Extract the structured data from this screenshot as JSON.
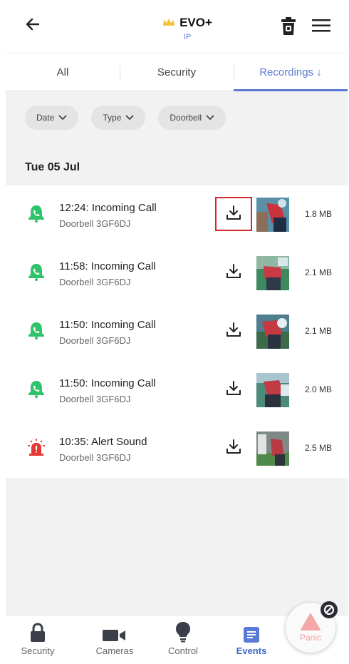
{
  "header": {
    "title": "EVO+",
    "subtitle": "IP",
    "icons": {
      "back": "arrow-left-icon",
      "crown": "crown-icon",
      "trash": "trash-icon",
      "menu": "hamburger-menu-icon"
    },
    "crown_color": "#f5c33b"
  },
  "tabs": [
    {
      "label": "All",
      "active": false
    },
    {
      "label": "Security",
      "active": false
    },
    {
      "label": "Recordings ↓",
      "active": true
    }
  ],
  "filters": [
    {
      "label": "Date"
    },
    {
      "label": "Type"
    },
    {
      "label": "Doorbell"
    }
  ],
  "date_heading": "Tue 05 Jul",
  "events": [
    {
      "time_title": "12:24: Incoming Call",
      "device": "Doorbell 3GF6DJ",
      "size": "1.8 MB",
      "icon": "incoming-call-bell-icon",
      "highlighted": true
    },
    {
      "time_title": "11:58: Incoming Call",
      "device": "Doorbell 3GF6DJ",
      "size": "2.1 MB",
      "icon": "incoming-call-bell-icon",
      "highlighted": false
    },
    {
      "time_title": "11:50: Incoming Call",
      "device": "Doorbell 3GF6DJ",
      "size": "2.1 MB",
      "icon": "incoming-call-bell-icon",
      "highlighted": false
    },
    {
      "time_title": "11:50: Incoming Call",
      "device": "Doorbell 3GF6DJ",
      "size": "2.0 MB",
      "icon": "incoming-call-bell-icon",
      "highlighted": false
    },
    {
      "time_title": "10:35: Alert Sound",
      "device": "Doorbell 3GF6DJ",
      "size": "2.5 MB",
      "icon": "alarm-siren-icon",
      "highlighted": false
    }
  ],
  "bottom_nav": [
    {
      "label": "Security",
      "icon": "lock-icon",
      "active": false
    },
    {
      "label": "Cameras",
      "icon": "video-camera-icon",
      "active": false
    },
    {
      "label": "Control",
      "icon": "lightbulb-icon",
      "active": false
    },
    {
      "label": "Events",
      "icon": "events-list-icon",
      "active": true
    }
  ],
  "panic": {
    "label": "Panic",
    "icon": "warning-triangle-icon"
  },
  "colors": {
    "accent": "#5a7bd5",
    "call_green": "#2fc36b",
    "alert_red": "#e53935",
    "highlight_border": "#d62828"
  }
}
